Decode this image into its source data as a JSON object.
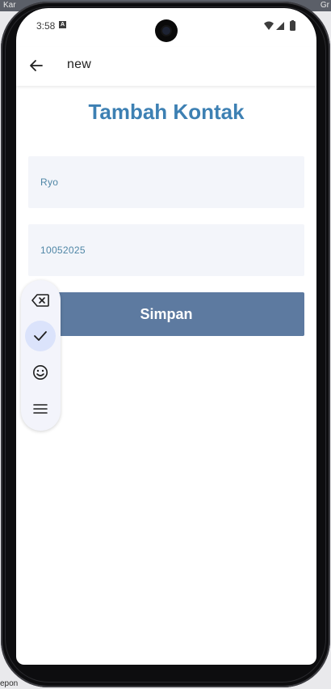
{
  "host": {
    "top_left_text": "Kar",
    "top_right_text": "Gr",
    "bottom_left_text": "epon"
  },
  "status_bar": {
    "time": "3:58",
    "notification_letter": "A"
  },
  "app_bar": {
    "back_icon": "arrow-left-icon",
    "title": "new"
  },
  "form": {
    "heading": "Tambah Kontak",
    "name_value": "Ryo",
    "phone_value": "10052025",
    "save_label": "Simpan"
  },
  "keyboard_toolbar": {
    "items": [
      {
        "icon": "backspace-icon",
        "active": false
      },
      {
        "icon": "check-icon",
        "active": true
      },
      {
        "icon": "emoji-icon",
        "active": false
      },
      {
        "icon": "menu-icon",
        "active": false
      }
    ]
  },
  "colors": {
    "title": "#3d80b3",
    "button": "#5d7aa0",
    "field_bg": "#f3f5fa",
    "field_text": "#4f86a6",
    "toolbar_active": "#dbe3fb"
  }
}
